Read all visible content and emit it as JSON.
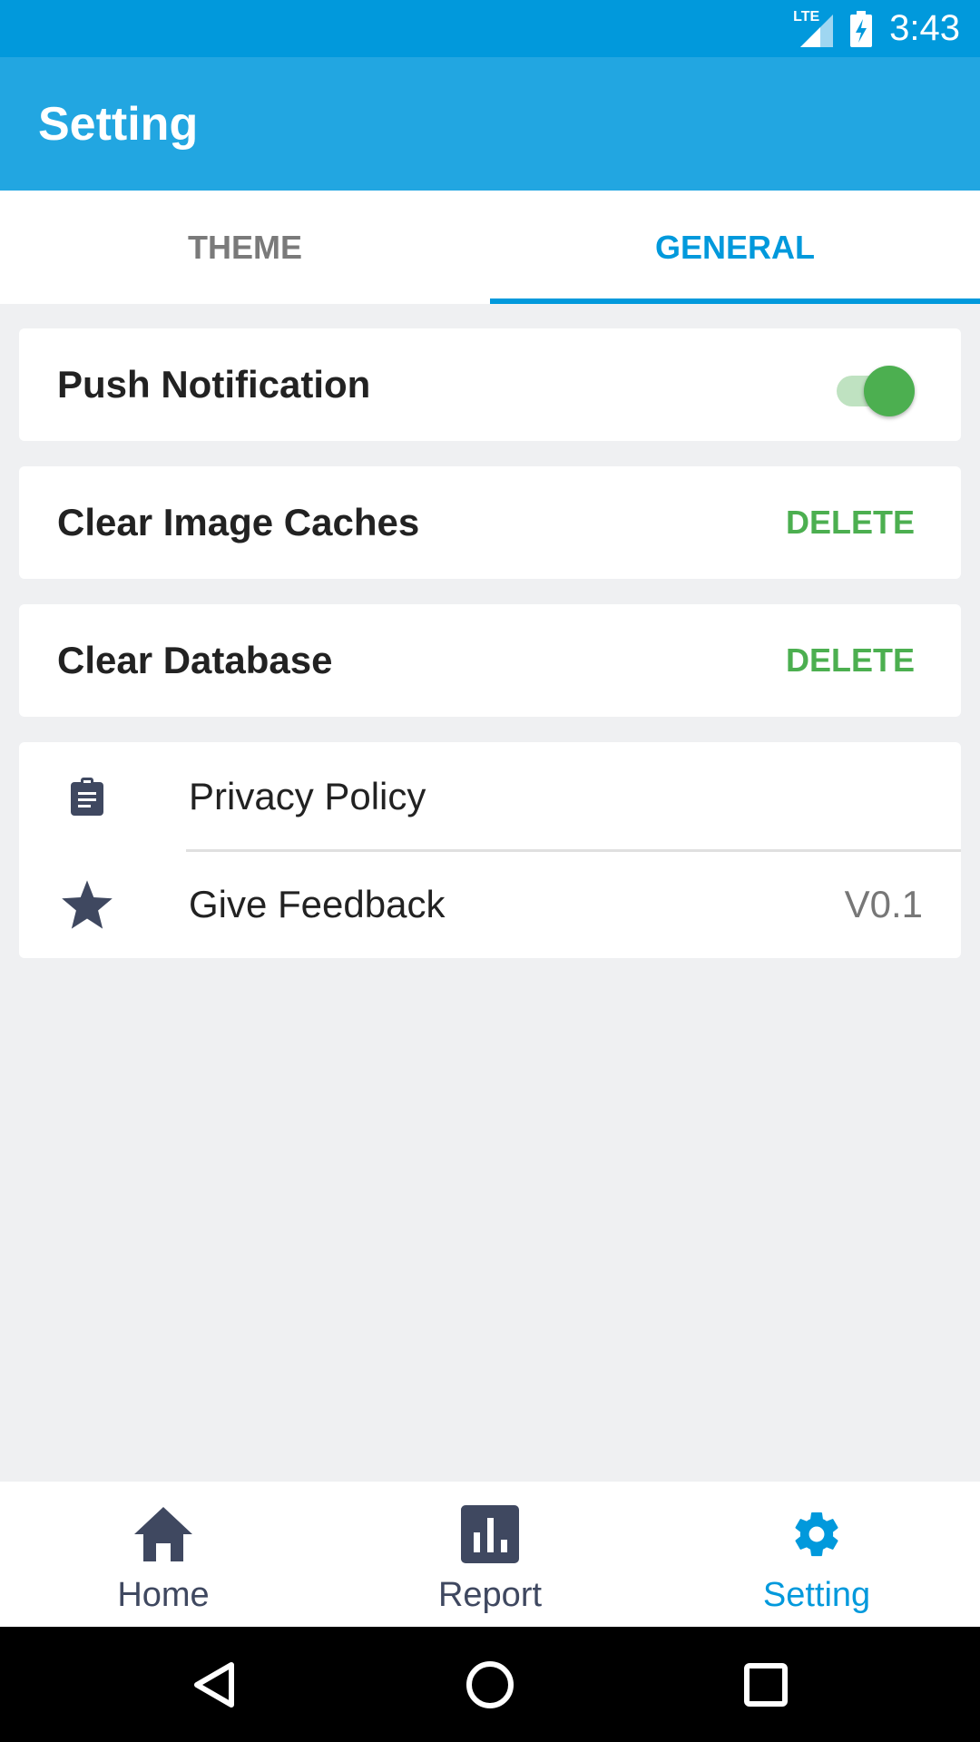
{
  "status_bar": {
    "network": "LTE",
    "time": "3:43"
  },
  "app_bar": {
    "title": "Setting"
  },
  "tabs": [
    {
      "label": "THEME",
      "active": false
    },
    {
      "label": "GENERAL",
      "active": true
    }
  ],
  "settings": {
    "push_notification": {
      "label": "Push Notification",
      "enabled": true
    },
    "clear_image_caches": {
      "label": "Clear Image Caches",
      "action": "DELETE"
    },
    "clear_database": {
      "label": "Clear Database",
      "action": "DELETE"
    }
  },
  "info_list": [
    {
      "icon": "clipboard-icon",
      "label": "Privacy Policy",
      "value": ""
    },
    {
      "icon": "star-icon",
      "label": "Give Feedback",
      "value": "V0.1"
    }
  ],
  "bottom_nav": [
    {
      "icon": "home-icon",
      "label": "Home",
      "active": false
    },
    {
      "icon": "bar-chart-icon",
      "label": "Report",
      "active": false
    },
    {
      "icon": "gear-icon",
      "label": "Setting",
      "active": true
    }
  ],
  "colors": {
    "status_bar": "#0199dc",
    "app_bar": "#22a6e1",
    "accent": "#0199dc",
    "action_green": "#4caf50",
    "icon_dark": "#3f4860"
  }
}
